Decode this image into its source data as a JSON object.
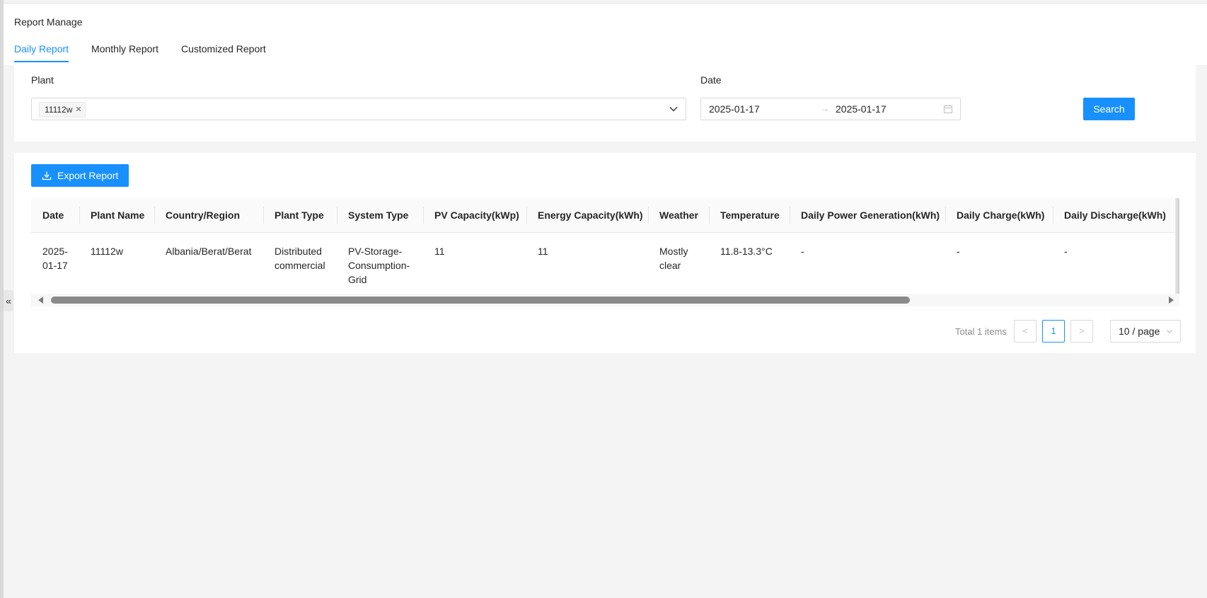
{
  "header": {
    "title": "Report Manage",
    "tabs": [
      {
        "label": "Daily Report",
        "active": true
      },
      {
        "label": "Monthly Report",
        "active": false
      },
      {
        "label": "Customized Report",
        "active": false
      }
    ]
  },
  "sidebar": {
    "collapse_glyph": "«"
  },
  "filters": {
    "plant_label": "Plant",
    "plant_tag": "11112w",
    "date_label": "Date",
    "date_start": "2025-01-17",
    "date_separator": "→",
    "date_end": "2025-01-17",
    "search_label": "Search"
  },
  "toolbar": {
    "export_label": "Export Report"
  },
  "table": {
    "columns": [
      "Date",
      "Plant Name",
      "Country/Region",
      "Plant Type",
      "System Type",
      "PV Capacity(kWp)",
      "Energy Capacity(kWh)",
      "Weather",
      "Temperature",
      "Daily Power Generation(kWh)",
      "Daily Charge(kWh)",
      "Daily Discharge(kWh)"
    ],
    "rows": [
      [
        "2025-01-17",
        "11112w",
        "Albania/Berat/Berat",
        "Distributed commercial",
        "PV-Storage-Consumption-Grid",
        "11",
        "11",
        "Mostly clear",
        "11.8-13.3°C",
        "-",
        "-",
        "-"
      ]
    ]
  },
  "pagination": {
    "total_text": "Total 1 items",
    "prev": "<",
    "current_page": "1",
    "next": ">",
    "page_size": "10 / page"
  },
  "colors": {
    "accent": "#1890ff",
    "background": "#f4f4f4"
  },
  "icons": [
    "chevron-down-icon",
    "calendar-icon",
    "download-icon",
    "close-icon"
  ]
}
